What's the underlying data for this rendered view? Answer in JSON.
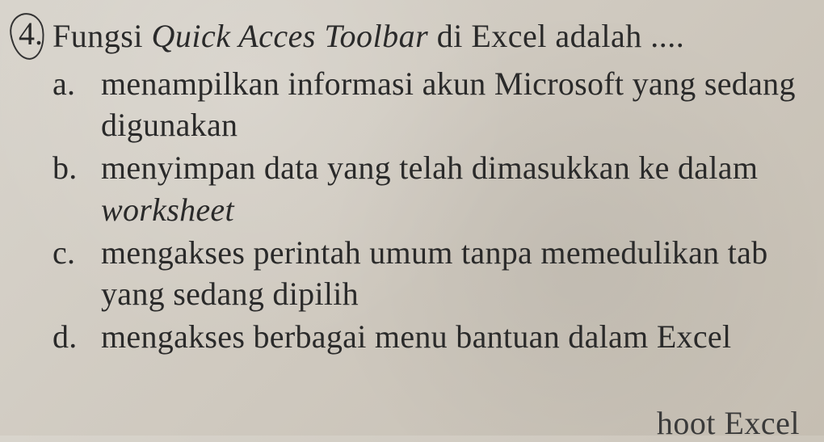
{
  "question": {
    "number": "4.",
    "text_pre": "Fungsi ",
    "text_italic": "Quick Acces Toolbar",
    "text_post": " di Excel adalah ....",
    "options": [
      {
        "letter": "a.",
        "text": "menampilkan informasi akun Microsoft yang sedang digunakan"
      },
      {
        "letter": "b.",
        "text_pre": "menyimpan data yang telah dimasukkan ke dalam ",
        "text_italic": "worksheet"
      },
      {
        "letter": "c.",
        "text": "mengakses perintah umum tanpa memedulikan tab yang sedang dipilih"
      },
      {
        "letter": "d.",
        "text": "mengakses berbagai menu bantuan dalam Excel"
      }
    ]
  },
  "partial_bottom": "hoot Excel"
}
